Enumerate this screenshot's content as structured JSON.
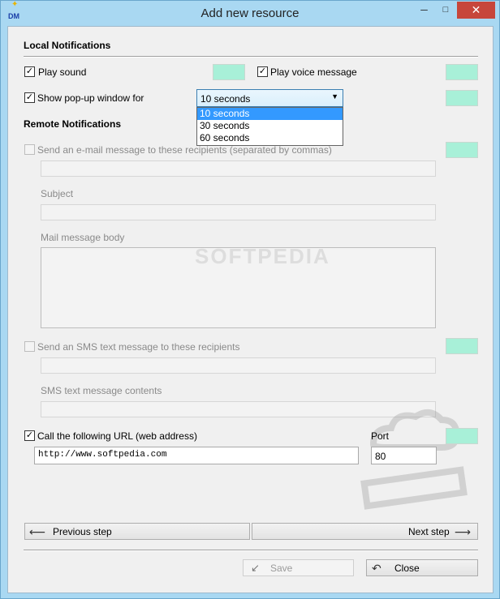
{
  "window": {
    "title": "Add new resource",
    "app_icon": "DM"
  },
  "local": {
    "heading": "Local Notifications",
    "play_sound": {
      "label": "Play sound",
      "checked": true
    },
    "play_voice": {
      "label": "Play voice message",
      "checked": true
    },
    "popup": {
      "label": "Show pop-up window for",
      "checked": true,
      "selected": "10 seconds",
      "options": [
        "10 seconds",
        "30 seconds",
        "60 seconds"
      ]
    }
  },
  "remote": {
    "heading": "Remote Notifications",
    "email": {
      "label": "Send an e-mail message to these recipients (separated by commas)",
      "checked": false,
      "subject_label": "Subject",
      "body_label": "Mail message body"
    },
    "sms": {
      "label": "Send an SMS text message to these recipients",
      "checked": false,
      "contents_label": "SMS text message contents"
    },
    "url": {
      "label": "Call the following URL (web address)",
      "checked": true,
      "value": "http://www.softpedia.com",
      "port_label": "Port",
      "port_value": "80"
    }
  },
  "nav": {
    "previous": "Previous step",
    "next": "Next step"
  },
  "footer": {
    "save": "Save",
    "close": "Close"
  },
  "watermark": "SOFTPEDIA",
  "colors": {
    "sound_swatch": "#a8f0d8",
    "selection": "#3399ff",
    "window_frame": "#a9d8f2"
  }
}
